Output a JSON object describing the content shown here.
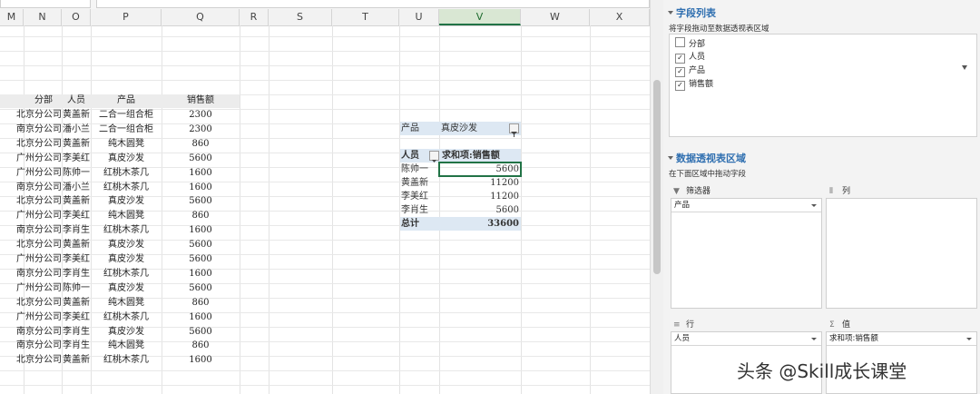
{
  "columns": [
    "M",
    "N",
    "O",
    "P",
    "Q",
    "R",
    "S",
    "T",
    "U",
    "V",
    "W",
    "X"
  ],
  "data_table": {
    "headers": [
      "分部",
      "人员",
      "产品",
      "销售额"
    ],
    "rows": [
      [
        "北京分公司",
        "黄盖新",
        "二合一组合柜",
        "2300"
      ],
      [
        "南京分公司",
        "潘小兰",
        "二合一组合柜",
        "2300"
      ],
      [
        "北京分公司",
        "黄盖新",
        "纯木圆凳",
        "860"
      ],
      [
        "广州分公司",
        "李美红",
        "真皮沙发",
        "5600"
      ],
      [
        "广州分公司",
        "陈帅一",
        "红桃木茶几",
        "1600"
      ],
      [
        "南京分公司",
        "潘小兰",
        "红桃木茶几",
        "1600"
      ],
      [
        "北京分公司",
        "黄盖新",
        "真皮沙发",
        "5600"
      ],
      [
        "广州分公司",
        "李美红",
        "纯木圆凳",
        "860"
      ],
      [
        "南京分公司",
        "李肖生",
        "红桃木茶几",
        "1600"
      ],
      [
        "北京分公司",
        "黄盖新",
        "真皮沙发",
        "5600"
      ],
      [
        "广州分公司",
        "李美红",
        "真皮沙发",
        "5600"
      ],
      [
        "南京分公司",
        "李肖生",
        "红桃木茶几",
        "1600"
      ],
      [
        "广州分公司",
        "陈帅一",
        "真皮沙发",
        "5600"
      ],
      [
        "北京分公司",
        "黄盖新",
        "纯木圆凳",
        "860"
      ],
      [
        "广州分公司",
        "李美红",
        "红桃木茶几",
        "1600"
      ],
      [
        "南京分公司",
        "李肖生",
        "真皮沙发",
        "5600"
      ],
      [
        "南京分公司",
        "李肖生",
        "纯木圆凳",
        "860"
      ],
      [
        "北京分公司",
        "黄盖新",
        "红桃木茶几",
        "1600"
      ]
    ]
  },
  "pivot": {
    "filter_label": "产品",
    "filter_value": "真皮沙发",
    "row_header": "人员",
    "value_header": "求和项:销售额",
    "rows": [
      {
        "name": "陈帅一",
        "value": "5600"
      },
      {
        "name": "黄盖新",
        "value": "11200"
      },
      {
        "name": "李美红",
        "value": "11200"
      },
      {
        "name": "李肖生",
        "value": "5600"
      }
    ],
    "total_label": "总计",
    "total_value": "33600"
  },
  "panel": {
    "field_list_title": "字段列表",
    "field_list_hint": "将字段拖动至数据透视表区域",
    "fields": [
      {
        "label": "分部",
        "checked": false
      },
      {
        "label": "人员",
        "checked": true
      },
      {
        "label": "产品",
        "checked": true
      },
      {
        "label": "销售额",
        "checked": true
      }
    ],
    "areas_title": "数据透视表区域",
    "areas_hint": "在下面区域中拖动字段",
    "filter_area_label": "筛选器",
    "column_area_label": "列",
    "row_area_label": "行",
    "value_area_label": "值",
    "filter_area_item": "产品",
    "row_area_item": "人员",
    "value_area_item": "求和项:销售额"
  },
  "watermark": "头条 @Skill成长课堂",
  "colors": {
    "accent": "#217346",
    "panel_title": "#2f6fb0"
  }
}
